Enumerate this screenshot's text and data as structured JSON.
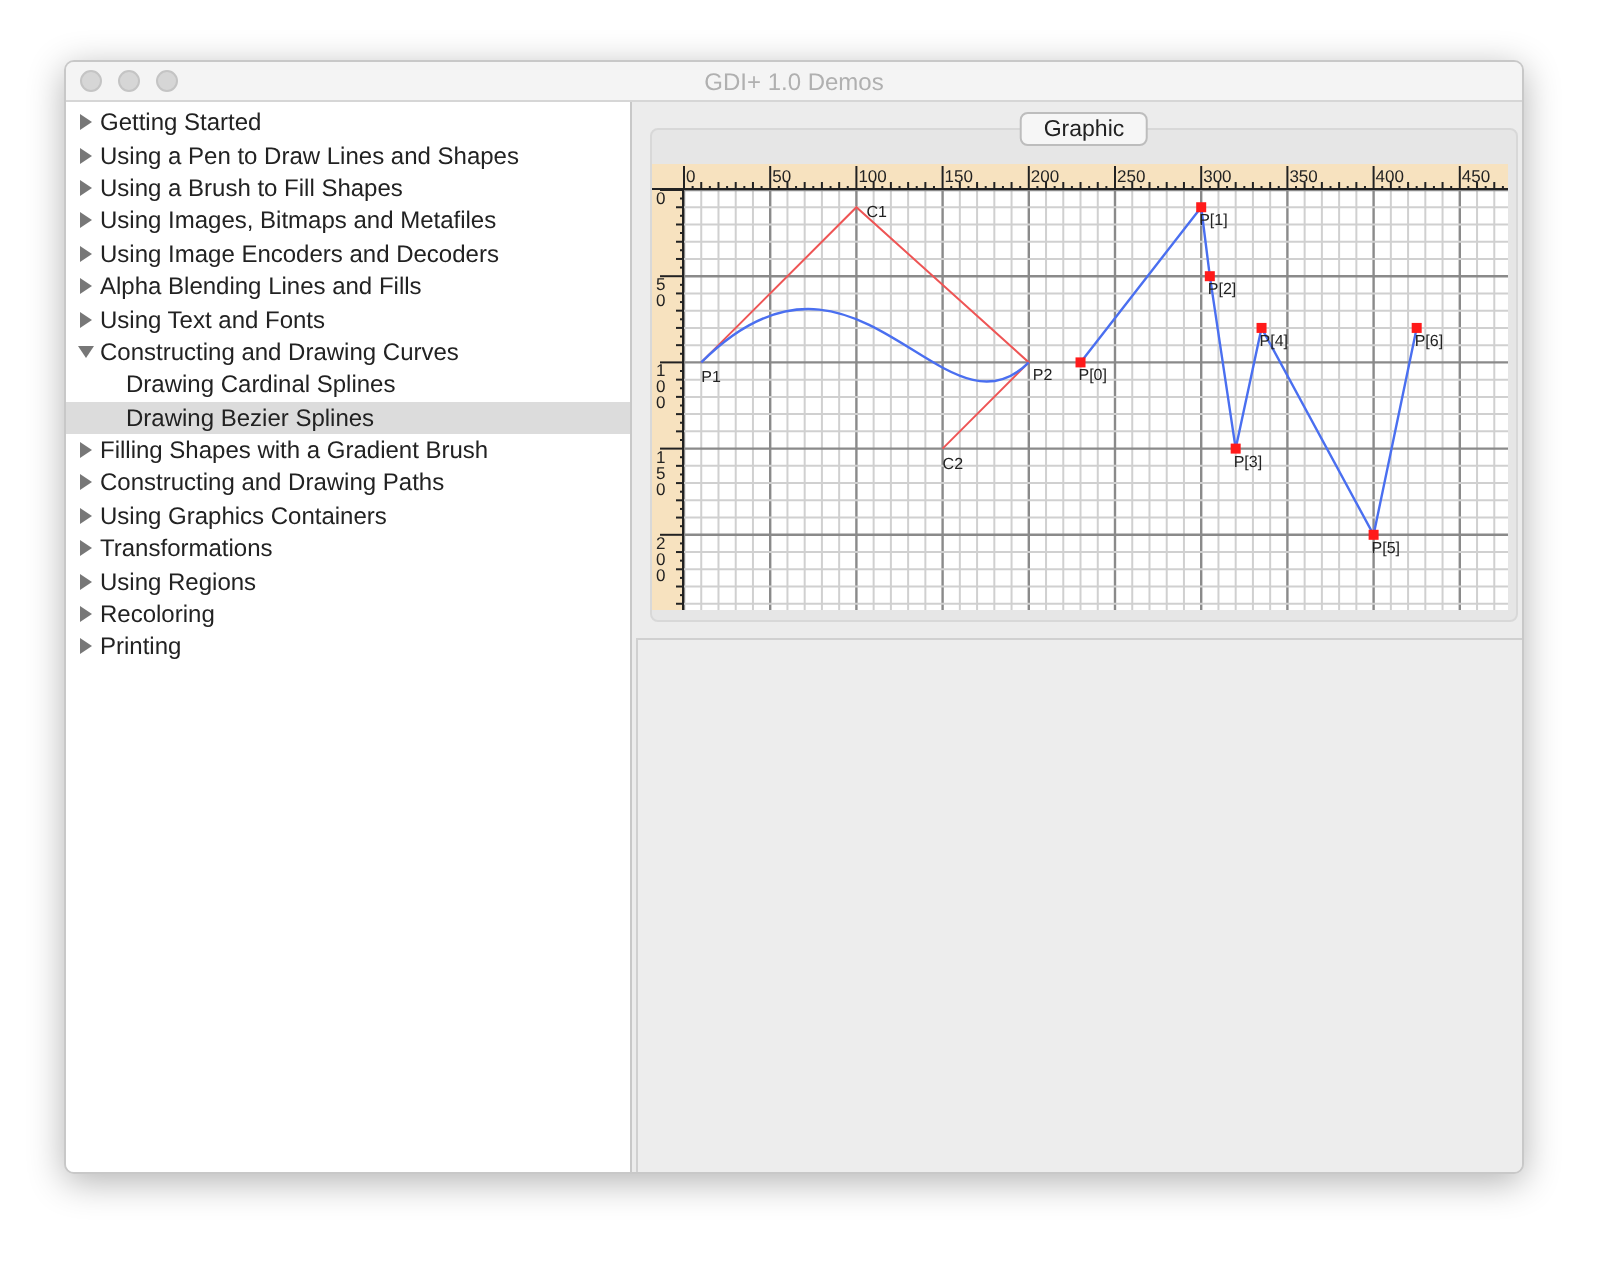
{
  "window": {
    "title": "GDI+ 1.0 Demos"
  },
  "sidebar": {
    "items": [
      {
        "label": "Getting Started",
        "expanded": false,
        "selected": false
      },
      {
        "label": "Using a Pen to Draw Lines and Shapes",
        "expanded": false,
        "selected": false
      },
      {
        "label": "Using a Brush to Fill Shapes",
        "expanded": false,
        "selected": false
      },
      {
        "label": "Using Images, Bitmaps and Metafiles",
        "expanded": false,
        "selected": false
      },
      {
        "label": "Using Image Encoders and Decoders",
        "expanded": false,
        "selected": false
      },
      {
        "label": "Alpha Blending Lines and Fills",
        "expanded": false,
        "selected": false
      },
      {
        "label": "Using Text and Fonts",
        "expanded": false,
        "selected": false
      },
      {
        "label": "Constructing and Drawing Curves",
        "expanded": true,
        "selected": false,
        "children": [
          {
            "label": "Drawing Cardinal Splines",
            "selected": false
          },
          {
            "label": "Drawing Bezier Splines",
            "selected": true
          }
        ]
      },
      {
        "label": "Filling Shapes with a Gradient Brush",
        "expanded": false,
        "selected": false
      },
      {
        "label": "Constructing and Drawing Paths",
        "expanded": false,
        "selected": false
      },
      {
        "label": "Using Graphics Containers",
        "expanded": false,
        "selected": false
      },
      {
        "label": "Transformations",
        "expanded": false,
        "selected": false
      },
      {
        "label": "Using Regions",
        "expanded": false,
        "selected": false
      },
      {
        "label": "Recoloring",
        "expanded": false,
        "selected": false
      },
      {
        "label": "Printing",
        "expanded": false,
        "selected": false
      }
    ]
  },
  "tab": {
    "label": "Graphic"
  },
  "canvas": {
    "top_ruler": [
      "0",
      "50",
      "100",
      "150",
      "200",
      "250",
      "300",
      "350",
      "400",
      "450"
    ],
    "left_ruler": [
      "0",
      "50",
      "100",
      "150",
      "200"
    ],
    "bezier_labels": [
      "P1",
      "C1",
      "C2",
      "P2"
    ],
    "spline_labels": [
      "P[0]",
      "P[1]",
      "P[2]",
      "P[3]",
      "P[4]",
      "P[5]",
      "P[6]"
    ]
  }
}
